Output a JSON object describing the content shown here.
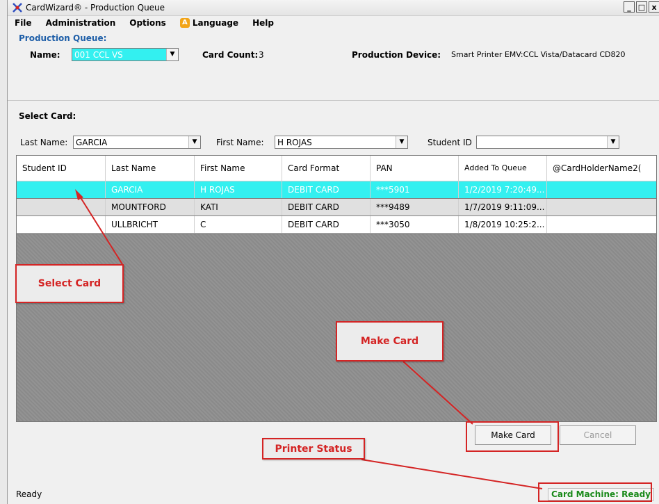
{
  "window": {
    "title": "CardWizard® - Production Queue",
    "controls": {
      "minimize": "_",
      "maximize": "□",
      "close": "x"
    }
  },
  "menu": {
    "file": "File",
    "administration": "Administration",
    "options": "Options",
    "language": "Language",
    "help": "Help"
  },
  "queue": {
    "section_title": "Production Queue:",
    "name_label": "Name:",
    "name_value": "001 CCL VS",
    "card_count_label": "Card Count:",
    "card_count_value": "3",
    "device_label": "Production Device:",
    "device_value": "Smart Printer EMV:CCL Vista/Datacard CD820"
  },
  "select_card": {
    "title": "Select Card:",
    "last_name_label": "Last Name:",
    "last_name_value": "GARCIA",
    "first_name_label": "First Name:",
    "first_name_value": "H ROJAS",
    "student_id_label": "Student ID",
    "student_id_value": ""
  },
  "table": {
    "columns": [
      "Student ID",
      "Last Name",
      "First Name",
      "Card Format",
      "PAN",
      "Added To Queue",
      "@CardHolderName2("
    ],
    "rows": [
      [
        "",
        "GARCIA",
        "H ROJAS",
        "DEBIT CARD",
        "***5901",
        "1/2/2019 7:20:49...",
        ""
      ],
      [
        "",
        "MOUNTFORD",
        "KATI",
        "DEBIT CARD",
        "***9489",
        "1/7/2019 9:11:09...",
        ""
      ],
      [
        "",
        "ULLBRICHT",
        "C",
        "DEBIT CARD",
        "***3050",
        "1/8/2019 10:25:2...",
        ""
      ]
    ]
  },
  "buttons": {
    "make_card": "Make Card",
    "cancel": "Cancel"
  },
  "status": {
    "left": "Ready",
    "right": "Card Machine: Ready"
  },
  "annotations": {
    "select_card": "Select Card",
    "make_card": "Make Card",
    "printer_status": "Printer Status",
    "color": "#d42424"
  },
  "colors": {
    "selected_row": "#33f0f0",
    "section_title": "#1f5fa8",
    "status_ready": "#1a8a1a"
  }
}
